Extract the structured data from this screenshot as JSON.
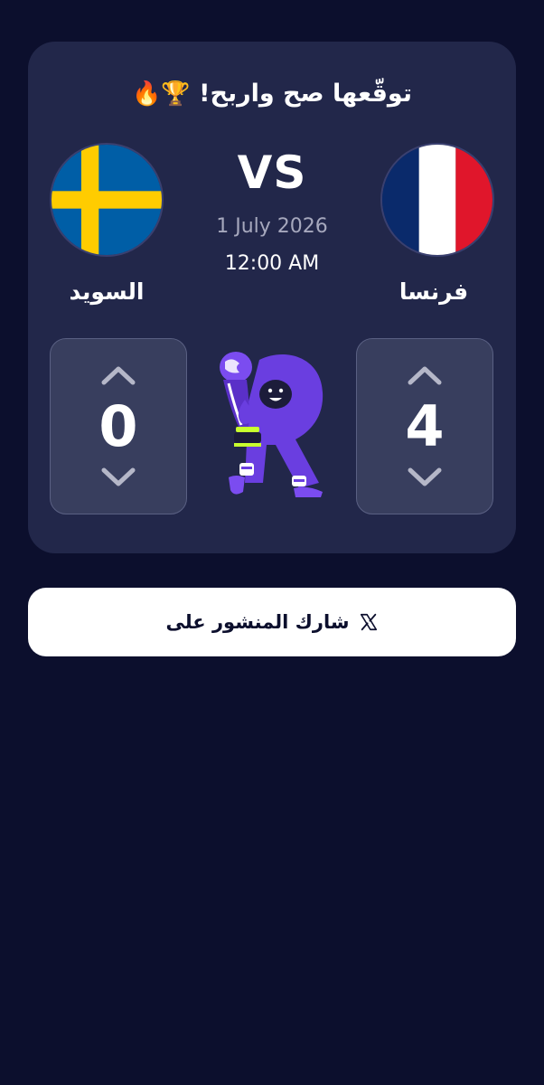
{
  "card": {
    "title": "توقّعها صح واربح!",
    "title_emojis": "🏆🔥",
    "vs_label": "VS",
    "date": "1 July 2026",
    "time": "12:00 AM"
  },
  "teams": {
    "left": {
      "name": "السويد",
      "flag": "sweden-flag",
      "score": "0"
    },
    "right": {
      "name": "فرنسا",
      "flag": "france-flag",
      "score": "4"
    }
  },
  "share": {
    "label": "شارك المنشور على",
    "icon": "x-logo-icon"
  },
  "colors": {
    "background": "#0c0f2d",
    "card": "#22274a",
    "score_box": "#383e5e",
    "accent_purple": "#6a3ee0"
  }
}
